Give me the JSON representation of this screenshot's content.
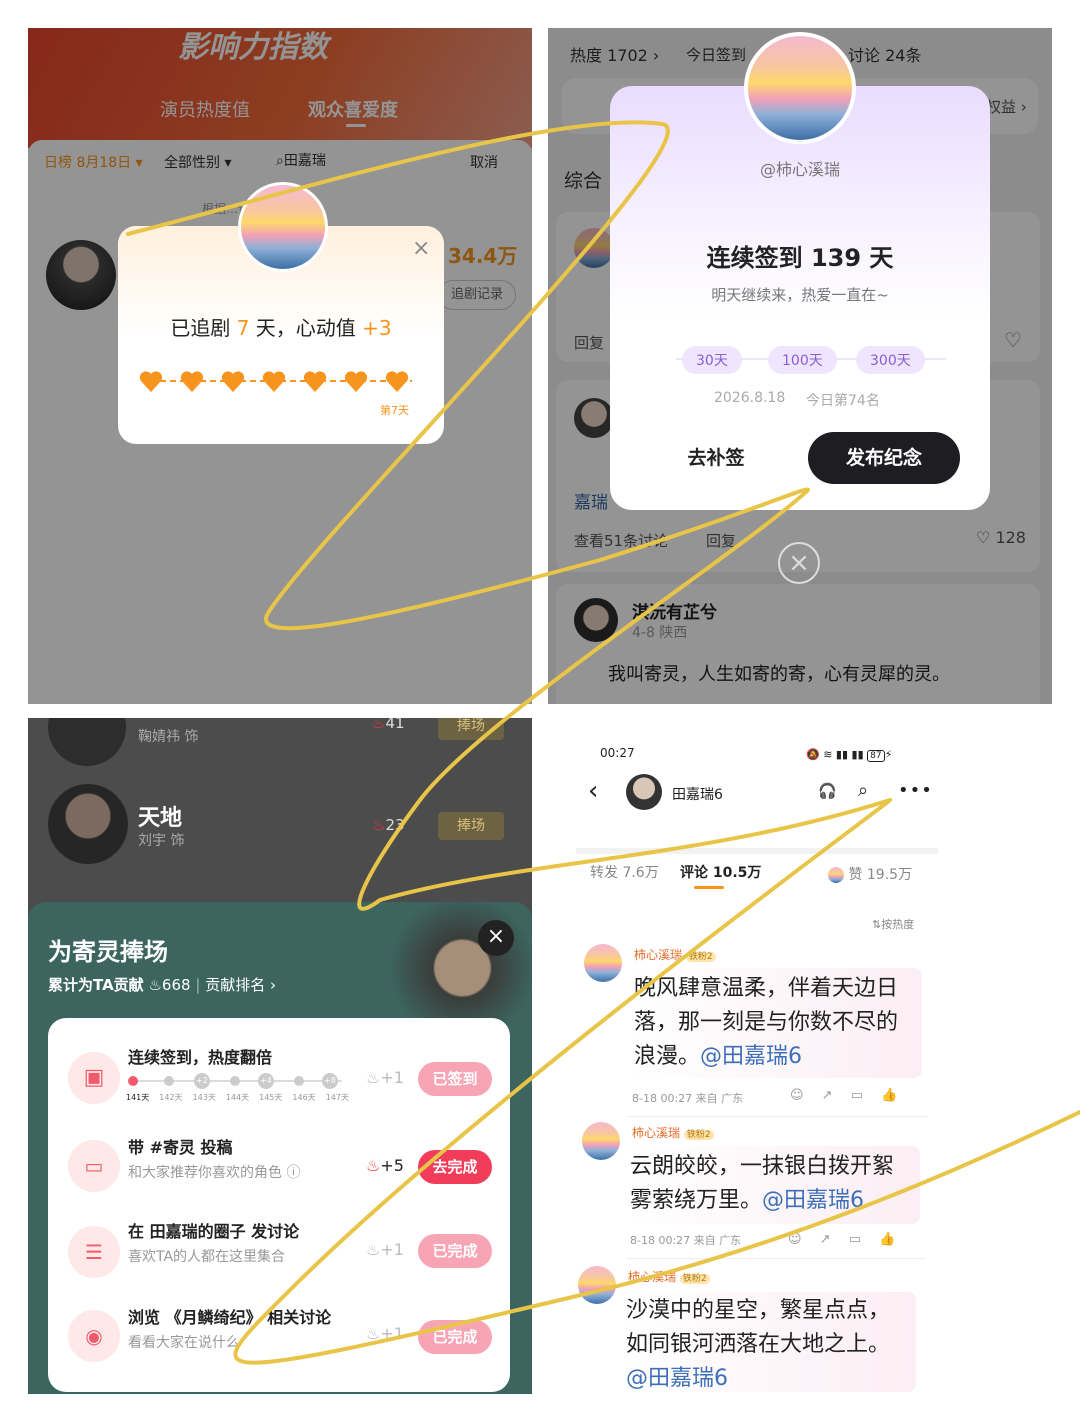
{
  "q1": {
    "banner_title": "影响力指数",
    "tabs": [
      "演员热度值",
      "观众喜爱度"
    ],
    "filter_date": "日榜 8月18日",
    "filter_gender": "全部性别",
    "search_text": "田嘉瑞",
    "cancel": "取消",
    "note": "根据…计算",
    "heat_value": "34.4万",
    "record_btn": "追剧记录",
    "popup": {
      "text_before": "已追剧 ",
      "days": "7",
      "text_after": " 天，心动值 ",
      "plus": "+3",
      "day_label": "第7天"
    }
  },
  "q2": {
    "heat": "热度 1702",
    "today_sign": "今日签到",
    "discuss": "讨论 24条",
    "benefit": "权益",
    "section": "综合",
    "reply": "回复",
    "user_tag": "嘉瑞",
    "view_discuss": "查看51条讨论",
    "reply2": "回复",
    "likes": "128",
    "post_user": "淇沅有芷兮",
    "post_meta": "4-8 陕西",
    "post_text": "我叫寄灵，人生如寄的寄，心有灵犀的灵。",
    "modal": {
      "username": "@柿心溪瑞",
      "title": "连续签到 139 天",
      "subtitle": "明天继续来，热爱一直在~",
      "milestones": [
        "30天",
        "100天",
        "300天"
      ],
      "date": "2026.8.18",
      "rank": "今日第74名",
      "btn_makeup": "去补签",
      "btn_publish": "发布纪念"
    }
  },
  "q3": {
    "actors": [
      {
        "role": "…",
        "actor": "鞠婧祎 饰",
        "score": "41",
        "btn": "捧场"
      },
      {
        "role": "天地",
        "actor": "刘宇 饰",
        "score": "23",
        "btn": "捧场"
      }
    ],
    "sheet": {
      "title": "为寄灵捧场",
      "contrib_label": "累计为TA贡献",
      "contrib_value": "668",
      "rank_link": "贡献排名",
      "tasks": [
        {
          "title": "连续签到，热度翻倍",
          "sub": "",
          "reward": "+1",
          "btn": "已签到",
          "state": "done"
        },
        {
          "title": "带 #寄灵 投稿",
          "sub": "和大家推荐你喜欢的角色",
          "reward": "+5",
          "btn": "去完成",
          "state": "todo"
        },
        {
          "title": "在 田嘉瑞的圈子 发讨论",
          "sub": "喜欢TA的人都在这里集合",
          "reward": "+1",
          "btn": "已完成",
          "state": "done"
        },
        {
          "title": "浏览 《月鳞绮纪》 相关讨论",
          "sub": "看看大家在说什么",
          "reward": "+1",
          "btn": "已完成",
          "state": "done"
        }
      ],
      "streak_days": [
        "141天",
        "142天",
        "143天",
        "144天",
        "145天",
        "146天",
        "147天"
      ],
      "streak_bonus": [
        "+2",
        "+4",
        "+8"
      ]
    }
  },
  "q4": {
    "time": "00:27",
    "battery": "87",
    "header_user": "田嘉瑞6",
    "repost": "转发 7.6万",
    "comments": "评论 10.5万",
    "likes": "赞 19.5万",
    "sort": "按热度",
    "comment_list": [
      {
        "user": "柿心溪瑞",
        "badge": "铁粉2",
        "text": "晚风肆意温柔，伴着天边日落，那一刻是与你数不尽的浪漫。",
        "mention": "@田嘉瑞6",
        "meta": "8-18 00:27 来自 广东"
      },
      {
        "user": "柿心溪瑞",
        "badge": "铁粉2",
        "text": "云朗皎皎，一抹银白拨开絮雾萦绕万里。",
        "mention": "@田嘉瑞6",
        "meta": "8-18 00:27 来自 广东"
      },
      {
        "user": "柿心溪瑞",
        "badge": "铁粉2",
        "text": "沙漠中的星空，繁星点点，如同银河洒落在大地之上。",
        "mention": "@田嘉瑞6",
        "meta": ""
      }
    ]
  },
  "colors": {
    "orange": "#f7941d",
    "red": "#f23d5a",
    "pink": "#f7a5b5",
    "dark": "#1d1d22",
    "purple": "#8a5fd0",
    "teal": "#3d6560",
    "gold": "#e8c548"
  }
}
